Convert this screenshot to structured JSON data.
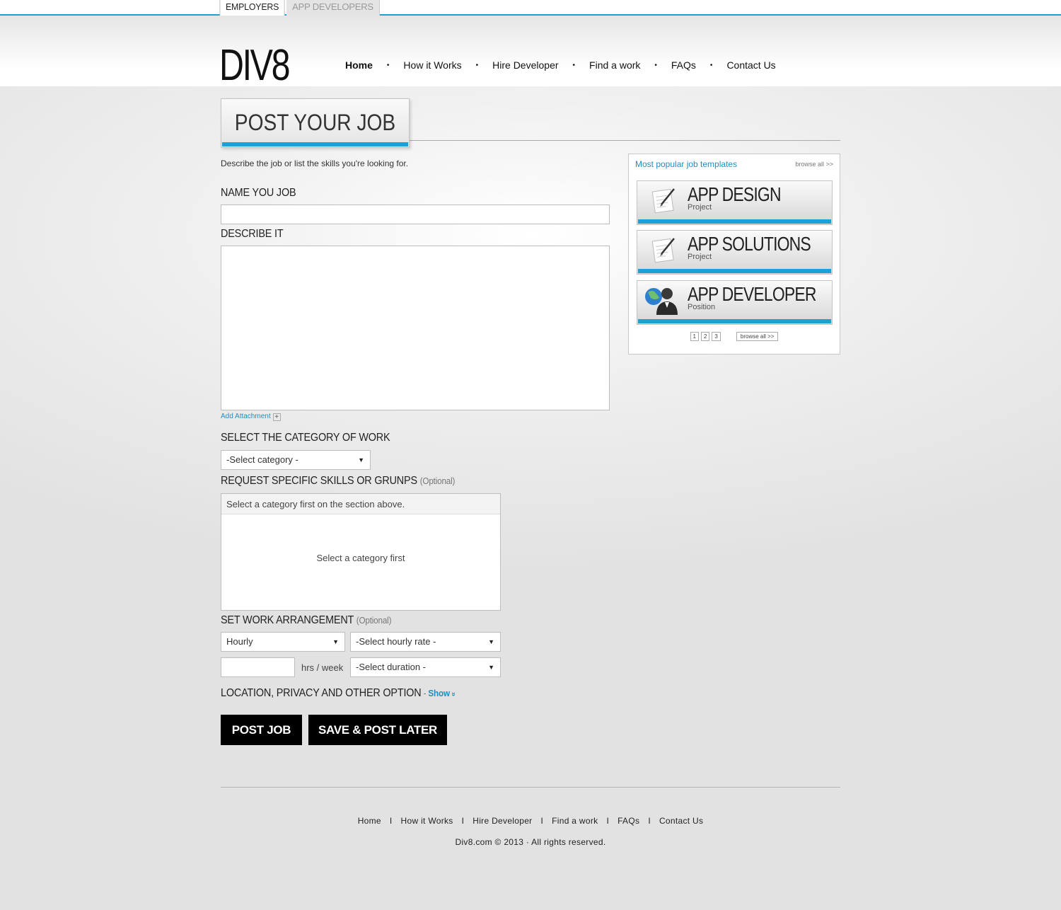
{
  "top_tabs": {
    "employers": "EMPLOYERS",
    "app_developers": "APP DEVELOPERS"
  },
  "header": {
    "logo": "DIV8",
    "nav": [
      "Home",
      "How it Works",
      "Hire Developer",
      "Find a work",
      "FAQs",
      "Contact Us"
    ],
    "nav_separator": "•"
  },
  "form": {
    "title": "POST YOUR JOB",
    "intro": "Describe the job or list the skills you're looking for.",
    "name_label": "NAME YOU JOB",
    "describe_label": "DESCRIBE IT",
    "attachment_label": "Add Attachment",
    "attachment_icon": "+",
    "category_label": "SELECT THE CATEGORY OF WORK",
    "category_value": "-Select category -",
    "skills_label": "REQUEST SPECIFIC SKILLS OR GRUNPS",
    "optional": "(Optional)",
    "skills_head": "Select a category first on the section above.",
    "skills_empty": "Select a category first",
    "arrangement_label": "SET WORK ARRANGEMENT",
    "arrangement_type": "Hourly",
    "hourly_rate": "-Select hourly rate -",
    "hrs_week": "hrs / week",
    "duration": "-Select duration -",
    "location_label": "LOCATION, PRIVACY AND OTHER OPTION",
    "location_sep": " - ",
    "show_label": "Show",
    "show_icon": "»",
    "caret": "▼",
    "post_button": "POST JOB",
    "save_button": "SAVE & POST LATER"
  },
  "sidebar": {
    "title": "Most popular job templates",
    "browse_all": "browse all >>",
    "templates": [
      {
        "name": "APP DESIGN",
        "type": "Project",
        "icon": "document-pencil-icon"
      },
      {
        "name": "APP SOLUTIONS",
        "type": "Project",
        "icon": "document-pencil-icon"
      },
      {
        "name": "APP DEVELOPER",
        "type": "Position",
        "icon": "person-globe-icon"
      }
    ],
    "pages": [
      "1",
      "2",
      "3"
    ],
    "pager_browse": "browse all >>"
  },
  "footer": {
    "nav": [
      "Home",
      "How it Works",
      "Hire Developer",
      "Find a work",
      "FAQs",
      "Contact Us"
    ],
    "separator": "I",
    "copyright": "Div8.com © 2013 · All rights reserved."
  },
  "colors": {
    "accent": "#1ba0d8",
    "link": "#1e8fc1",
    "button": "#000000"
  }
}
